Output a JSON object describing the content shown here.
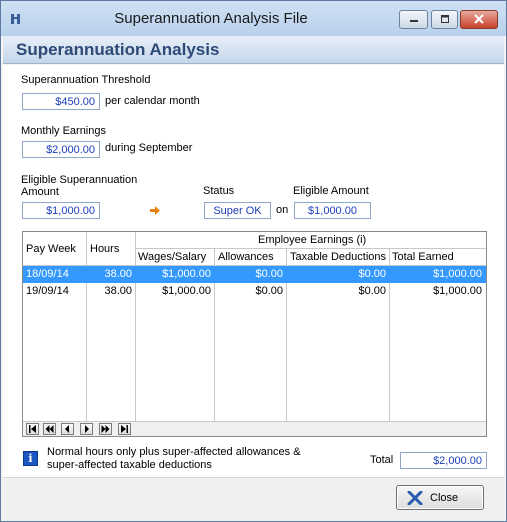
{
  "window": {
    "title": "Superannuation Analysis File"
  },
  "header": {
    "title": "Superannuation Analysis"
  },
  "threshold": {
    "label": "Superannuation Threshold",
    "value": "$450.00",
    "suffix": "per calendar month"
  },
  "earnings": {
    "label": "Monthly Earnings",
    "value": "$2,000.00",
    "suffix": "during September"
  },
  "eligible": {
    "label_line1": "Eligible Superannuation",
    "label_line2": "Amount",
    "value": "$1,000.00",
    "status_label": "Status",
    "status_value": "Super OK",
    "on_text": "on",
    "eligible_amount_label": "Eligible Amount",
    "eligible_amount_value": "$1,000.00"
  },
  "grid": {
    "group_header": "Employee Earnings (i)",
    "columns": [
      "Pay Week",
      "Hours",
      "Wages/Salary",
      "Allowances",
      "Taxable Deductions",
      "Total Earned"
    ],
    "rows": [
      {
        "pay_week": "18/09/14",
        "hours": "38.00",
        "wages": "$1,000.00",
        "allowances": "$0.00",
        "deductions": "$0.00",
        "total": "$1,000.00",
        "selected": true
      },
      {
        "pay_week": "19/09/14",
        "hours": "38.00",
        "wages": "$1,000.00",
        "allowances": "$0.00",
        "deductions": "$0.00",
        "total": "$1,000.00",
        "selected": false
      }
    ]
  },
  "note": {
    "line1": "Normal hours only plus super-affected  allowances &",
    "line2": "super-affected taxable deductions"
  },
  "total": {
    "label": "Total",
    "value": "$2,000.00"
  },
  "footer": {
    "close_label": "Close"
  },
  "colors": {
    "selection": "#3399ff",
    "value_text": "#1c3fb8",
    "header_title": "#2c4a75",
    "arrow": "#e8820c",
    "close_x": "#2a5db0"
  }
}
